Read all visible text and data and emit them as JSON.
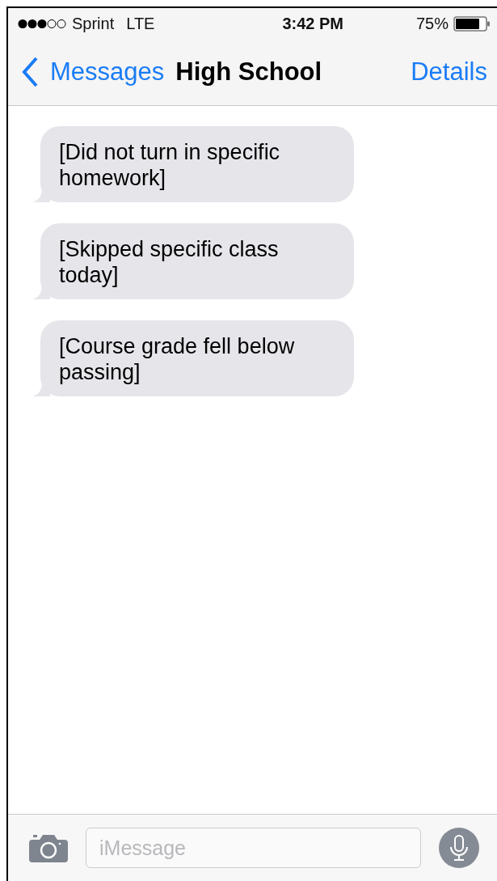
{
  "status_bar": {
    "carrier": "Sprint",
    "network": "LTE",
    "time": "3:42 PM",
    "battery": "75%"
  },
  "nav_bar": {
    "back": "Messages",
    "title": "High School",
    "action": "Details"
  },
  "messages": [
    {
      "kind": "received",
      "text": "[Did not turn in specific homework]"
    },
    {
      "kind": "received",
      "text": "[Skipped specific class today]"
    },
    {
      "kind": "received",
      "text": "[Course grade fell below passing]"
    }
  ],
  "compose": {
    "placeholder": "iMessage"
  }
}
